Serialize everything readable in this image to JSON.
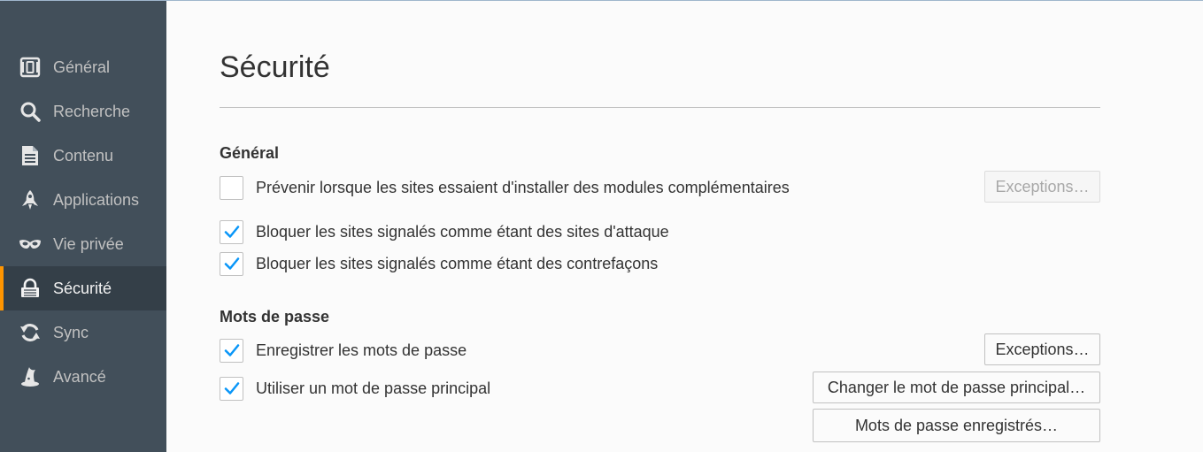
{
  "sidebar": {
    "items": [
      {
        "label": "Général",
        "icon": "general-icon",
        "active": false
      },
      {
        "label": "Recherche",
        "icon": "search-icon",
        "active": false
      },
      {
        "label": "Contenu",
        "icon": "document-icon",
        "active": false
      },
      {
        "label": "Applications",
        "icon": "rocket-icon",
        "active": false
      },
      {
        "label": "Vie privée",
        "icon": "mask-icon",
        "active": false
      },
      {
        "label": "Sécurité",
        "icon": "lock-icon",
        "active": true
      },
      {
        "label": "Sync",
        "icon": "sync-icon",
        "active": false
      },
      {
        "label": "Avancé",
        "icon": "wizard-hat-icon",
        "active": false
      }
    ]
  },
  "page": {
    "title": "Sécurité"
  },
  "general": {
    "heading": "Général",
    "options": [
      {
        "label": "Prévenir lorsque les sites essaient d'installer des modules complémentaires",
        "checked": false
      },
      {
        "label": "Bloquer les sites signalés comme étant des sites d'attaque",
        "checked": true
      },
      {
        "label": "Bloquer les sites signalés comme étant des contrefaçons",
        "checked": true
      }
    ],
    "exceptions_button": {
      "label": "Exceptions…",
      "enabled": false
    }
  },
  "passwords": {
    "heading": "Mots de passe",
    "options": [
      {
        "label": "Enregistrer les mots de passe",
        "checked": true
      },
      {
        "label": "Utiliser un mot de passe principal",
        "checked": true
      }
    ],
    "exceptions_button": {
      "label": "Exceptions…",
      "enabled": true
    },
    "change_master_button": {
      "label": "Changer le mot de passe principal…"
    },
    "saved_passwords_button": {
      "label": "Mots de passe enregistrés…"
    }
  },
  "colors": {
    "sidebar_bg": "#424f5a",
    "sidebar_active_bg": "#343f48",
    "accent": "#ff9500",
    "checkmark": "#0996f8"
  }
}
